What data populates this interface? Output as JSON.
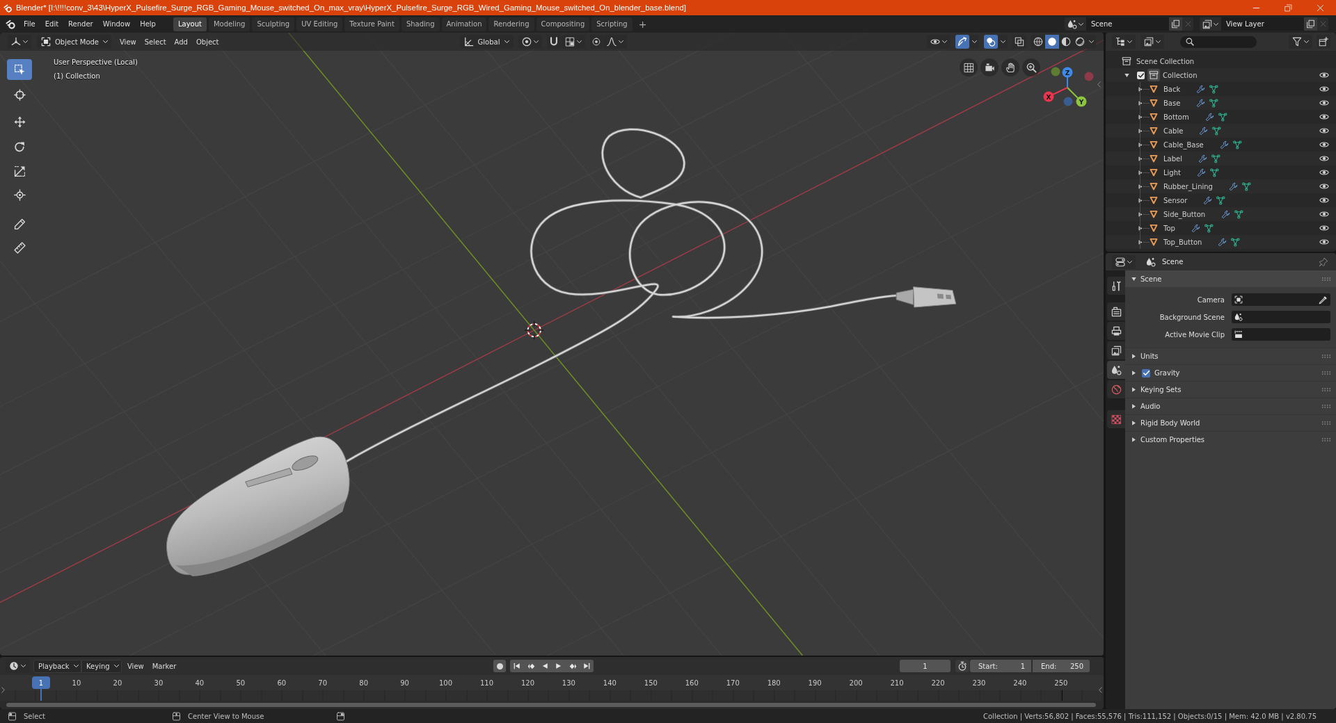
{
  "window": {
    "title": "Blender* [I:\\!!!!conv_3\\43\\HyperX_Pulsefire_Surge_RGB_Gaming_Mouse_switched_On_max_vray\\HyperX_Pulsefire_Surge_RGB_Wired_Gaming_Mouse_switched_On_blender_base.blend]"
  },
  "menu": [
    "File",
    "Edit",
    "Render",
    "Window",
    "Help"
  ],
  "workspaces": {
    "tabs": [
      {
        "label": "Layout",
        "selected": true
      },
      {
        "label": "Modeling",
        "selected": false
      },
      {
        "label": "Sculpting",
        "selected": false
      },
      {
        "label": "UV Editing",
        "selected": false
      },
      {
        "label": "Texture Paint",
        "selected": false
      },
      {
        "label": "Shading",
        "selected": false
      },
      {
        "label": "Animation",
        "selected": false
      },
      {
        "label": "Rendering",
        "selected": false
      },
      {
        "label": "Compositing",
        "selected": false
      },
      {
        "label": "Scripting",
        "selected": false
      }
    ],
    "add": "+"
  },
  "scene_selector": {
    "value": "Scene"
  },
  "view_layer_selector": {
    "value": "View Layer"
  },
  "viewport": {
    "header": {
      "mode": "Object Mode",
      "menus": [
        "View",
        "Select",
        "Add",
        "Object"
      ],
      "orientation": "Global",
      "show_gizmos": true,
      "show_overlays": true,
      "xray": false,
      "shading": [
        {
          "selected": false
        },
        {
          "selected": true
        },
        {
          "selected": false
        },
        {
          "selected": false
        }
      ]
    },
    "tools": [
      {
        "selected": true
      },
      {
        "selected": false
      },
      {
        "selected": false
      },
      {
        "selected": false
      },
      {
        "selected": false
      },
      {
        "selected": false
      },
      {
        "selected": false
      },
      {
        "selected": false
      }
    ],
    "info": [
      "User Perspective (Local)",
      "(1) Collection"
    ],
    "gizmo": {
      "x": "X",
      "y": "Y",
      "z": "Z"
    }
  },
  "outliner": {
    "root": "Scene Collection",
    "collections": [
      {
        "name": "Collection",
        "expanded": true,
        "checked": true,
        "visible": true,
        "children": [
          {
            "name": "Back",
            "expanded": false,
            "visible": true
          },
          {
            "name": "Base",
            "expanded": false,
            "visible": true
          },
          {
            "name": "Bottom",
            "expanded": false,
            "visible": true
          },
          {
            "name": "Cable",
            "expanded": false,
            "visible": true
          },
          {
            "name": "Cable_Base",
            "expanded": false,
            "visible": true
          },
          {
            "name": "Label",
            "expanded": false,
            "visible": true
          },
          {
            "name": "Light",
            "expanded": false,
            "visible": true
          },
          {
            "name": "Rubber_Lining",
            "expanded": false,
            "visible": true
          },
          {
            "name": "Sensor",
            "expanded": false,
            "visible": true
          },
          {
            "name": "Side_Button",
            "expanded": false,
            "visible": true
          },
          {
            "name": "Top",
            "expanded": false,
            "visible": true
          },
          {
            "name": "Top_Button",
            "expanded": false,
            "visible": true
          }
        ]
      }
    ]
  },
  "properties": {
    "context": "Scene",
    "tabs": [
      {
        "selected": false
      },
      {
        "selected": false
      },
      {
        "selected": false
      },
      {
        "selected": false
      },
      {
        "selected": true
      },
      {
        "selected": false
      },
      {
        "selected": false
      }
    ],
    "panels": [
      {
        "kind": "plain",
        "title": "Scene",
        "expanded": true,
        "fields": [
          {
            "label": "Camera"
          },
          {
            "label": "Background Scene"
          },
          {
            "label": "Active Movie Clip"
          }
        ]
      },
      {
        "kind": "plain",
        "title": "Units",
        "expanded": false
      },
      {
        "kind": "toggle",
        "title": "Gravity",
        "expanded": false,
        "checked": true
      },
      {
        "kind": "plain",
        "title": "Keying Sets",
        "expanded": false
      },
      {
        "kind": "plain",
        "title": "Audio",
        "expanded": false
      },
      {
        "kind": "plain",
        "title": "Rigid Body World",
        "expanded": false
      },
      {
        "kind": "plain",
        "title": "Custom Properties",
        "expanded": false
      }
    ]
  },
  "timeline": {
    "dropdowns": [
      "Playback",
      "Keying"
    ],
    "menus": [
      "View",
      "Marker"
    ],
    "auto_keying": false,
    "current_frame": "1",
    "start_label": "Start:",
    "start": "1",
    "end_label": "End:",
    "end": "250",
    "playhead": "1",
    "ruler": [
      "10",
      "20",
      "30",
      "40",
      "50",
      "60",
      "70",
      "80",
      "90",
      "100",
      "110",
      "120",
      "130",
      "140",
      "150",
      "160",
      "170",
      "180",
      "190",
      "200",
      "210",
      "220",
      "230",
      "240",
      "250"
    ]
  },
  "status_bar": {
    "hints": [
      "Select",
      "Center View to Mouse"
    ],
    "stats": "Collection | Verts:56,802 | Faces:55,576 | Tris:111,152 | Objects:0/15 | Mem: 42.0 MB | v2.80.75"
  }
}
